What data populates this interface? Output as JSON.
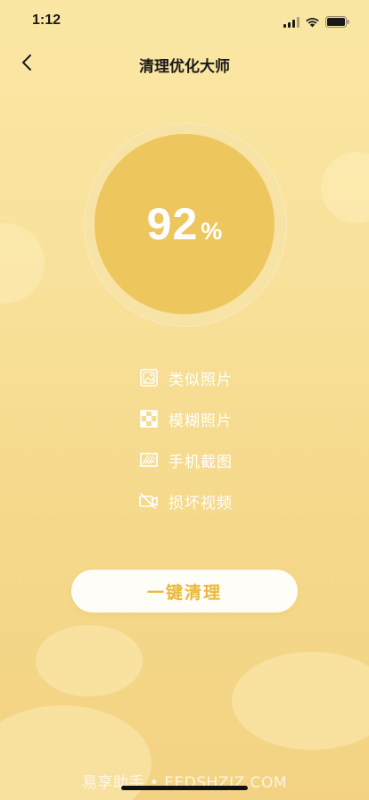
{
  "status_bar": {
    "time": "1:12",
    "icons": [
      "signal-icon",
      "wifi-icon",
      "battery-icon"
    ]
  },
  "nav": {
    "title": "清理优化大师",
    "back_icon": "chevron-left-icon"
  },
  "progress": {
    "value": "92",
    "unit": "%",
    "fraction": 0.92
  },
  "items": [
    {
      "label": "类似照片",
      "icon": "photo-icon"
    },
    {
      "label": "模糊照片",
      "icon": "blur-grid-icon"
    },
    {
      "label": "手机截图",
      "icon": "screenshot-icon"
    },
    {
      "label": "损坏视频",
      "icon": "video-off-icon"
    }
  ],
  "action": {
    "label": "一键清理"
  },
  "watermark": "易享助手 • EEDSHZJZ.COM",
  "colors": {
    "background": "#f8e19a",
    "circle": "#edc75e",
    "ring": "#f8e3a6",
    "button_text": "#e9b93a"
  }
}
